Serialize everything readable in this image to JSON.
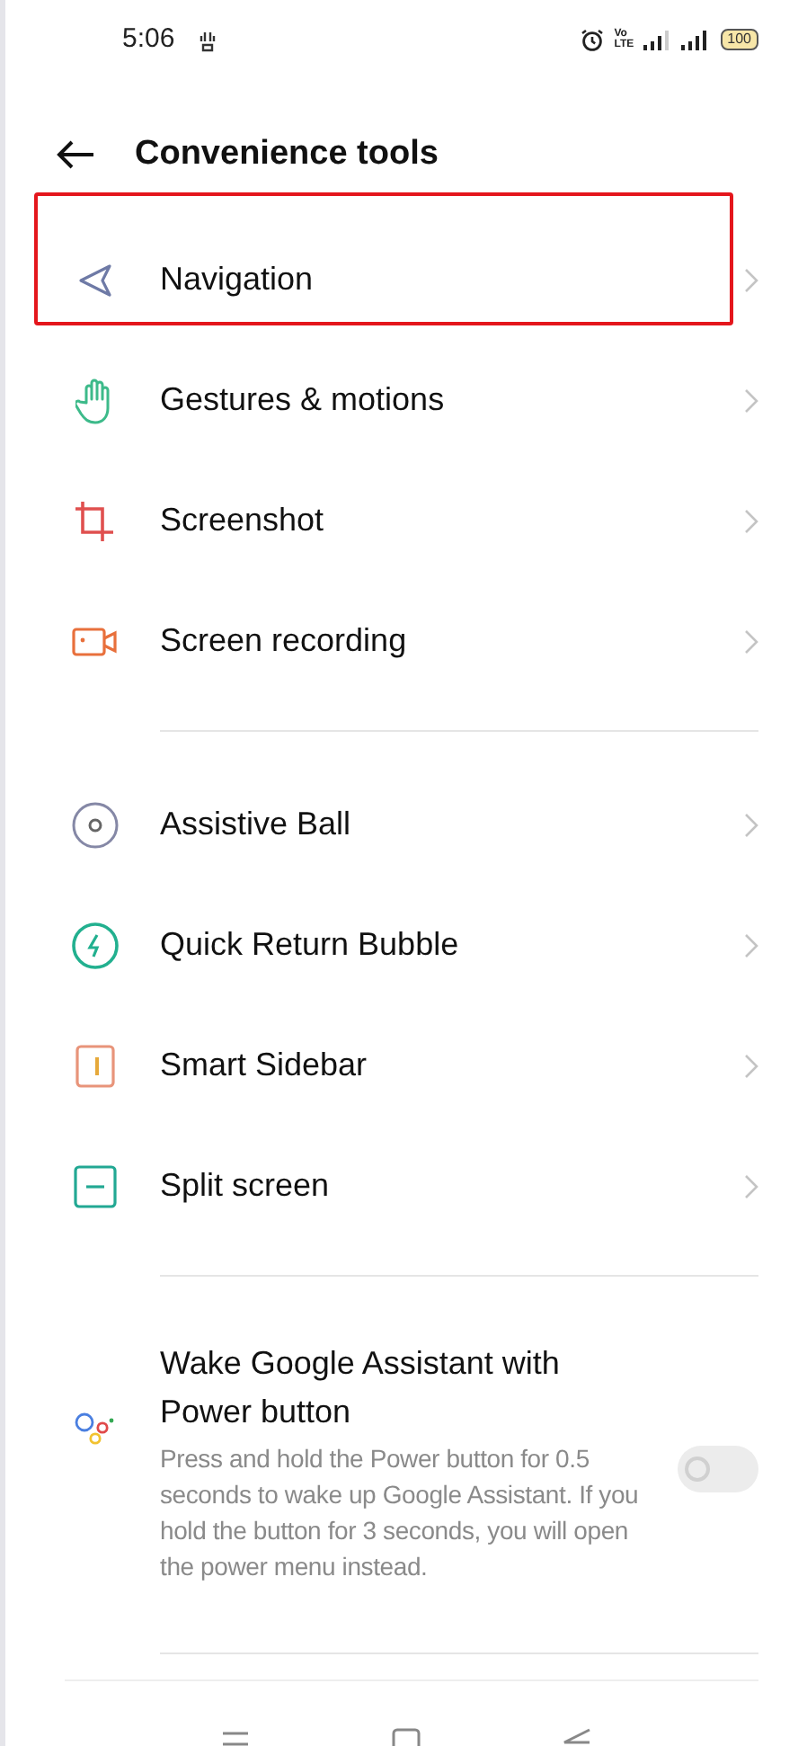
{
  "status_bar": {
    "time": "5:06",
    "volte_top": "Vo",
    "volte_bottom": "LTE",
    "battery": "100"
  },
  "header": {
    "title": "Convenience tools"
  },
  "sections": [
    {
      "items": [
        {
          "kind": "link",
          "label": "Navigation",
          "highlighted": true
        },
        {
          "kind": "link",
          "label": "Gestures & motions",
          "highlighted": false
        },
        {
          "kind": "link",
          "label": "Screenshot",
          "highlighted": false
        },
        {
          "kind": "link",
          "label": "Screen recording",
          "highlighted": false
        }
      ]
    },
    {
      "items": [
        {
          "kind": "link",
          "label": "Assistive Ball",
          "highlighted": false
        },
        {
          "kind": "link",
          "label": "Quick Return Bubble",
          "highlighted": false
        },
        {
          "kind": "link",
          "label": "Smart Sidebar",
          "highlighted": false
        },
        {
          "kind": "link",
          "label": "Split screen",
          "highlighted": false
        }
      ]
    },
    {
      "items": [
        {
          "kind": "toggle",
          "label": "Wake Google Assistant with Power button",
          "description": "Press and hold the Power button for 0.5 seconds to wake up Google Assistant. If you hold the button for 3 seconds, you will open the power menu instead.",
          "on": false
        }
      ]
    }
  ]
}
